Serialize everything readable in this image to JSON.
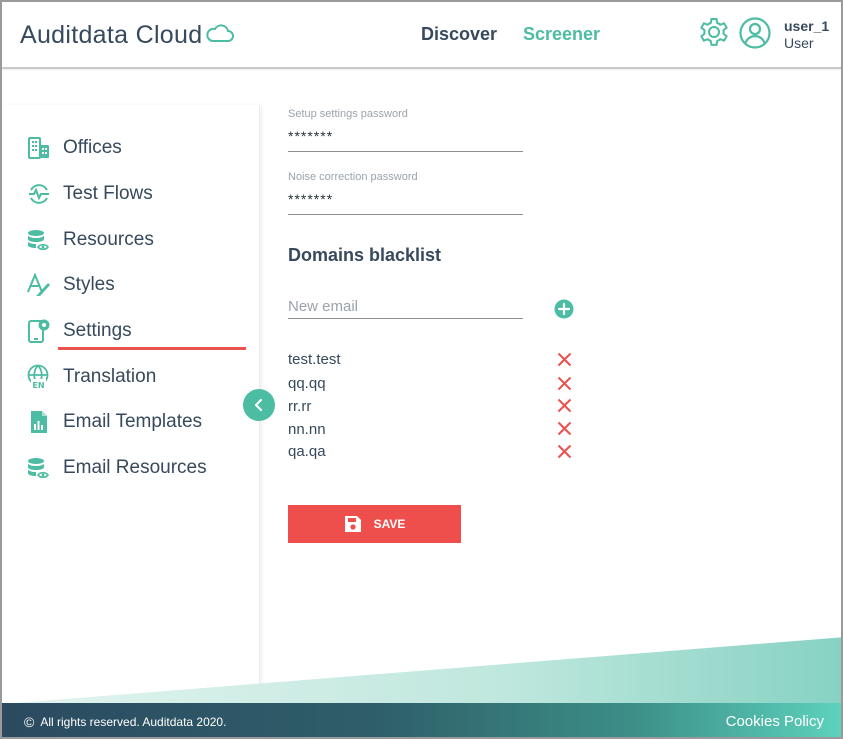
{
  "header": {
    "logo_text": "Auditdata Cloud",
    "nav": {
      "discover": "Discover",
      "screener": "Screener"
    },
    "user": {
      "name": "user_1",
      "role": "User"
    }
  },
  "sidebar": {
    "items": [
      {
        "label": "Offices",
        "icon": "building-icon"
      },
      {
        "label": "Test Flows",
        "icon": "test-flows-icon"
      },
      {
        "label": "Resources",
        "icon": "resources-icon"
      },
      {
        "label": "Styles",
        "icon": "styles-icon"
      },
      {
        "label": "Settings",
        "icon": "settings-device-icon"
      },
      {
        "label": "Translation",
        "icon": "translation-globe-icon"
      },
      {
        "label": "Email Templates",
        "icon": "email-template-icon"
      },
      {
        "label": "Email Resources",
        "icon": "email-resources-icon"
      }
    ],
    "active_item": "Settings"
  },
  "form": {
    "setup_password": {
      "label": "Setup settings password",
      "value": "*******"
    },
    "noise_password": {
      "label": "Noise correction password",
      "value": "*******"
    },
    "blacklist": {
      "title": "Domains blacklist",
      "new_email_placeholder": "New email",
      "items": [
        "test.test",
        "qq.qq",
        "rr.rr",
        "nn.nn",
        "qa.qa"
      ]
    },
    "save_label": "SAVE"
  },
  "footer": {
    "copyright_symbol": "©",
    "copyright": "All rights reserved. Auditdata 2020.",
    "cookies": "Cookies Policy"
  },
  "colors": {
    "primary": "#37495c",
    "accent": "#4cbca3",
    "danger": "#ef4f4c"
  }
}
